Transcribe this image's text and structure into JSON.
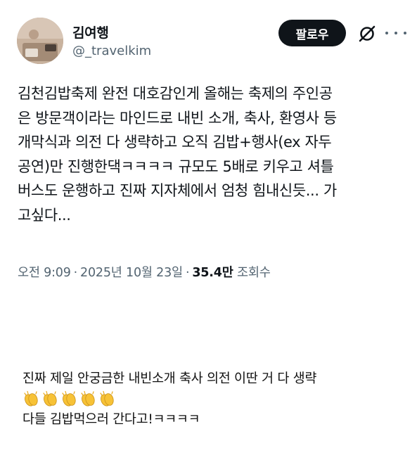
{
  "profile": {
    "display_name": "김여행",
    "handle": "@_travelkim",
    "follow_label": "팔로우",
    "avatar_icon": "avatar-photo-icon",
    "grok_icon": "grok-icon",
    "more_icon": "more-options-icon"
  },
  "tweet": {
    "lines": [
      "김천김밥축제 완전 대호감인게 올해는 축제의 주인공",
      "은 방문객이라는 마인드로 내빈 소개, 축사, 환영사 등",
      "개막식과 의전 다 생략하고 오직 김밥+행사(ex 자두",
      "공연)만 진행한댁ㅋㅋㅋㅋ 규모도 5배로 키우고 셔틀",
      "버스도 운행하고 진짜 지자체에서 엄청 힘내신듯... 가",
      "고싶다..."
    ],
    "time": "오전 9:09",
    "date": "2025년 10월 23일",
    "views_count": "35.4만",
    "views_label": "조회수"
  },
  "caption": {
    "line1": "진짜 제일 안궁금한 내빈소개 축사 의전 이딴 거 다 생략",
    "clap_count": 5,
    "clap_icon": "clapping-hands-icon",
    "line3": "다들 김밥먹으러 간다고!ㅋㅋㅋㅋ"
  },
  "colors": {
    "text": "#0f1419",
    "secondary": "#536471",
    "button_bg": "#0f1419",
    "button_text": "#ffffff",
    "clap_yellow": "#f7c236"
  }
}
